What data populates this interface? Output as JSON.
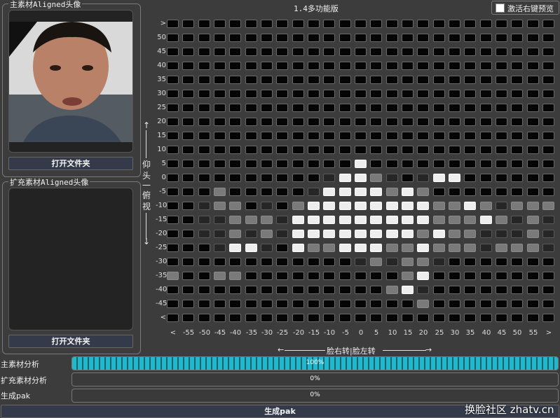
{
  "title": "1.4多功能版",
  "preview_toggle": {
    "label": "激活右键预览",
    "checked": false
  },
  "primary_panel": {
    "title": "主素材Aligned头像",
    "button": "打开文件夹"
  },
  "extended_panel": {
    "title": "扩充素材Aligned头像",
    "button": "打开文件夹"
  },
  "grid": {
    "y_labels": [
      ">",
      "50",
      "45",
      "40",
      "35",
      "30",
      "25",
      "20",
      "15",
      "10",
      "5",
      "0",
      "-5",
      "-10",
      "-15",
      "-20",
      "-25",
      "-30",
      "-35",
      "-40",
      "-45",
      "<"
    ],
    "x_labels": [
      "<",
      "-55",
      "-50",
      "-45",
      "-40",
      "-35",
      "-30",
      "-25",
      "-20",
      "-15",
      "-10",
      "-5",
      "0",
      "5",
      "10",
      "15",
      "20",
      "25",
      "30",
      "35",
      "40",
      "45",
      "50",
      "55",
      ">"
    ],
    "vertical_axis": {
      "top": "仰",
      "mid1": "头",
      "mid2": "一",
      "mid3": "俯",
      "bottom": "视"
    },
    "horizontal_axis": "脸右转|脸左转",
    "levels": [
      "0000000000000000000000000",
      "0000000000000000000000000",
      "0000000000000000000000000",
      "0000000000000000000000000",
      "0000000000000000000000000",
      "0000000000000000000000000",
      "0000000000000000000000000",
      "0000000000000000000000000",
      "0000000000000000000000000",
      "0000000000000000000000000",
      "0000000000003000000000000",
      "0000000000133210133000000",
      "0002000001333323200000000",
      "0012201023333333322321222",
      "0011222133333333322232121",
      "0011212133333333232211121",
      "0001331032233322322212221",
      "0000000000001212210000000",
      "2002200000000002300000000",
      "0000000000000023100000000",
      "0000000000000000200000000",
      "0000000000000000000000000"
    ]
  },
  "progress": [
    {
      "label": "主素材分析",
      "value": 100,
      "text": "100%"
    },
    {
      "label": "扩充素材分析",
      "value": 0,
      "text": "0%"
    },
    {
      "label": "生成pak",
      "value": 0,
      "text": "0%"
    }
  ],
  "generate_button": "生成pak",
  "watermark": "换脸社区 zhatv.cn"
}
